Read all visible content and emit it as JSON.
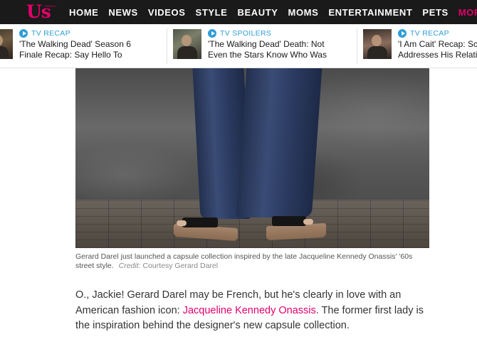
{
  "site": {
    "logo_text": "Us",
    "logo_subtext": "WEEKLY",
    "accent_color": "#e2006a",
    "tag_color": "#2e9fd8"
  },
  "nav": {
    "items": [
      "HOME",
      "NEWS",
      "VIDEOS",
      "STYLE",
      "BEAUTY",
      "MOMS",
      "ENTERTAINMENT",
      "PETS"
    ],
    "more_label": "MOR"
  },
  "trending": [
    {
      "tag": "TV RECAP",
      "headline": "'The Walking Dead' Season 6\nFinale Recap: Say Hello To",
      "icon": "play-icon"
    },
    {
      "tag": "TV SPOILERS",
      "headline": "'The Walking Dead' Death: Not\nEven the Stars Know Who Was",
      "icon": "play-icon"
    },
    {
      "tag": "TV RECAP",
      "headline": "'I Am Cait' Recap: Sc\nAddresses His Relatio",
      "icon": "play-icon"
    }
  ],
  "photo": {
    "caption": "Gerard Darel just launched a capsule collection inspired by the late Jacqueline Kennedy Onassis' '60s street style.",
    "credit_label": "Credit:",
    "credit_value": "Courtesy Gerard Darel"
  },
  "article": {
    "intro_before_link": "O., Jackie! Gerard Darel may be French, but he's clearly in love with an American fashion icon: ",
    "link_text": "Jacqueline Kennedy Onassis",
    "intro_after_link": ". The former first lady is the inspiration behind the designer's new capsule collection."
  }
}
